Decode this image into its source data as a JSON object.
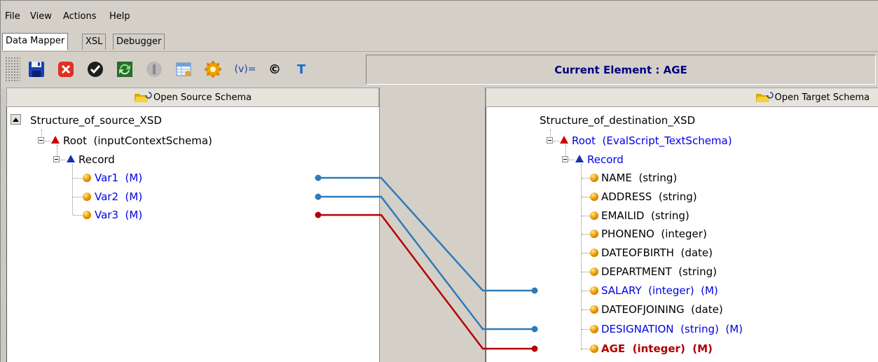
{
  "menu": {
    "file": "File",
    "view": "View",
    "actions": "Actions",
    "help": "Help"
  },
  "tabs": {
    "data_mapper": "Data Mapper",
    "xsl": "XSL",
    "debugger": "Debugger"
  },
  "toolbar": {
    "buttons": [
      "save-icon",
      "cancel-icon",
      "validate-icon",
      "refresh-icon",
      "stop-icon",
      "table-icon",
      "settings-icon",
      "variable-icon",
      "constant-icon",
      "text-icon"
    ],
    "variable_label": "(v)=",
    "constant_label": "©",
    "text_label": "T"
  },
  "current_element": "Current Element : AGE",
  "source": {
    "open_label": "Open Source Schema",
    "root_title": "Structure_of_source_XSD",
    "root": "Root  (inputContextSchema)",
    "record": "Record",
    "vars": [
      "Var1  (M)",
      "Var2  (M)",
      "Var3  (M)"
    ]
  },
  "target": {
    "open_label": "Open Target Schema",
    "root_title": "Structure_of_destination_XSD",
    "root": "Root  (EvalScript_TextSchema)",
    "record": "Record",
    "fields": [
      "NAME  (string)",
      "ADDRESS  (string)",
      "EMAILID  (string)",
      "PHONENO  (integer)",
      "DATEOFBIRTH  (date)",
      "DEPARTMENT  (string)",
      "SALARY  (integer)  (M)",
      "DATEOFJOINING  (date)",
      "DESIGNATION  (string)  (M)",
      "AGE  (integer)  (M)"
    ]
  },
  "colors": {
    "blue_link": "#2f7ab8",
    "red_link": "#b50000",
    "mapped_text": "#0000e6",
    "current_text": "#b00000"
  }
}
